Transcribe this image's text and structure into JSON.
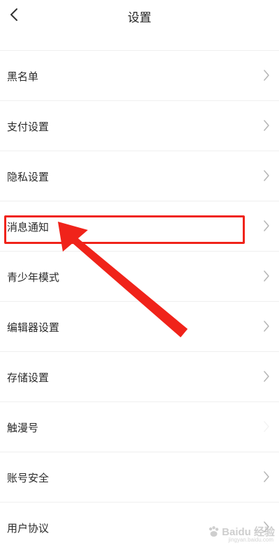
{
  "header": {
    "title": "设置"
  },
  "settings": {
    "items": [
      {
        "label": "黑名单"
      },
      {
        "label": "支付设置"
      },
      {
        "label": "隐私设置"
      },
      {
        "label": "消息通知"
      },
      {
        "label": "青少年模式"
      },
      {
        "label": "编辑器设置"
      },
      {
        "label": "存储设置"
      },
      {
        "label": "触漫号"
      },
      {
        "label": "账号安全"
      },
      {
        "label": "用户协议"
      }
    ]
  },
  "annotation": {
    "color": "#f0231a",
    "highlighted_item": "消息通知"
  },
  "watermark": {
    "brand": "Baidu 经验",
    "url": "jingyan.baidu.com"
  }
}
